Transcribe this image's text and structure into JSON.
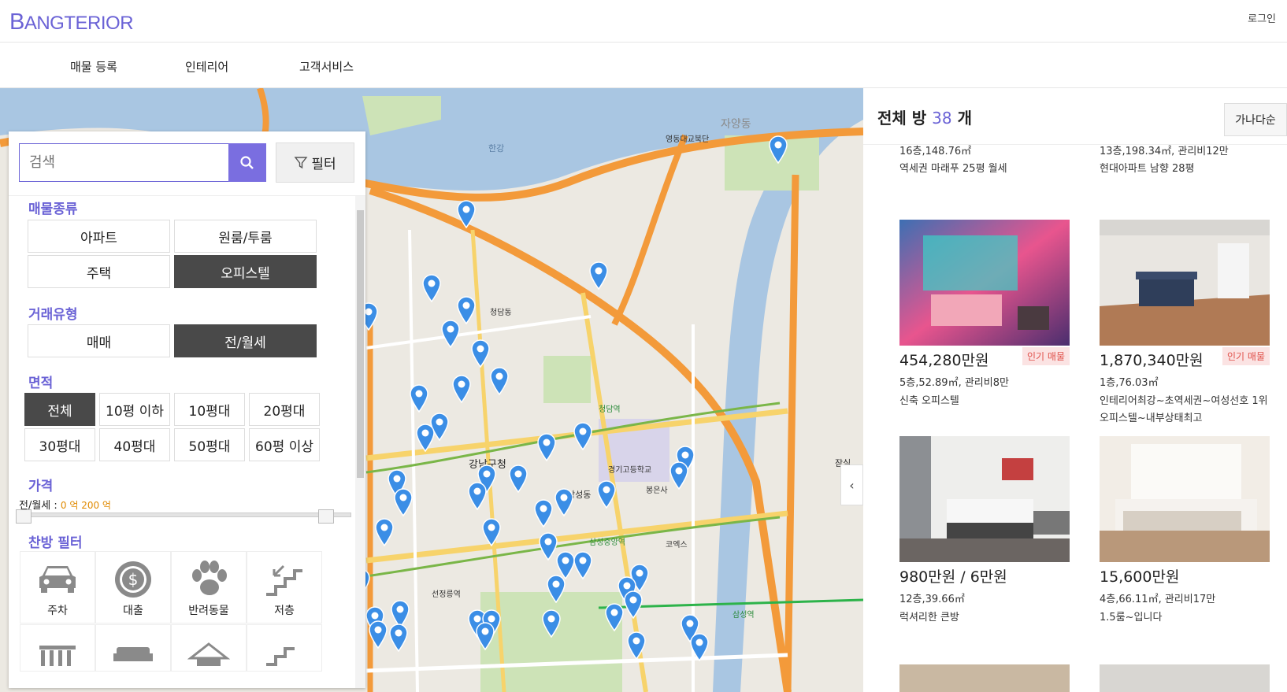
{
  "header": {
    "logo_first": "B",
    "logo_rest": "ANGTERIOR",
    "login": "로그인"
  },
  "nav": {
    "items": [
      "매물 등록",
      "인테리어",
      "고객서비스"
    ]
  },
  "search": {
    "placeholder": "검색",
    "filter_label": "필터"
  },
  "filters": {
    "property_type": {
      "title": "매물종류",
      "options": [
        "아파트",
        "원룸/투룸",
        "주택",
        "오피스텔"
      ],
      "selected": "오피스텔"
    },
    "trade_type": {
      "title": "거래유형",
      "options": [
        "매매",
        "전/월세"
      ],
      "selected": "전/월세"
    },
    "area": {
      "title": "면적",
      "options": [
        "전체",
        "10평 이하",
        "10평대",
        "20평대",
        "30평대",
        "40평대",
        "50평대",
        "60평 이상"
      ],
      "selected": "전체"
    },
    "price": {
      "title": "가격",
      "label": "전/월세 : ",
      "range_text": "0 억 200 억"
    },
    "features": {
      "title": "찬방 필터",
      "items": [
        {
          "icon": "car-icon",
          "label": "주차"
        },
        {
          "icon": "loan-icon",
          "label": "대출"
        },
        {
          "icon": "paw-icon",
          "label": "반려동물"
        },
        {
          "icon": "stairs-icon",
          "label": "저층"
        }
      ]
    }
  },
  "map": {
    "labels": [
      "한강",
      "영동대교북단",
      "청담동",
      "삼성동",
      "강남구청",
      "봉은사",
      "삼성역",
      "선정릉역",
      "청담역",
      "경기고등학교",
      "코엑스",
      "삼성중앙역",
      "자양동",
      "잠실"
    ],
    "colors": {
      "river": "#a9c6e2",
      "highway": "#f39a3a",
      "park": "#cde3b7",
      "pin": "#3b8ee6"
    }
  },
  "listing": {
    "count_prefix": "전체 방",
    "count": "38",
    "count_suffix": "개",
    "sort": "가나다순",
    "top": [
      {
        "meta": "16층,148.76㎡",
        "desc": "역세권 마래푸 25평 월세"
      },
      {
        "meta": "13층,198.34㎡, 관리비12만",
        "desc": "현대아파트 남향 28평"
      }
    ],
    "cards": [
      {
        "price": "454,280만원",
        "badge": "인기 매물",
        "meta": "5층,52.89㎡, 관리비8만",
        "desc": "신축 오피스텔"
      },
      {
        "price": "1,870,340만원",
        "badge": "인기 매물",
        "meta": "1층,76.03㎡",
        "desc": "인테리어최강~초역세권~여성선호 1위오피스텔~내부상태최고"
      },
      {
        "price": "980만원 / 6만원",
        "badge": "",
        "meta": "12층,39.66㎡",
        "desc": "럭셔리한 큰방"
      },
      {
        "price": "15,600만원",
        "badge": "",
        "meta": "4층,66.11㎡, 관리비17만",
        "desc": "1.5룸~입니다"
      }
    ]
  }
}
